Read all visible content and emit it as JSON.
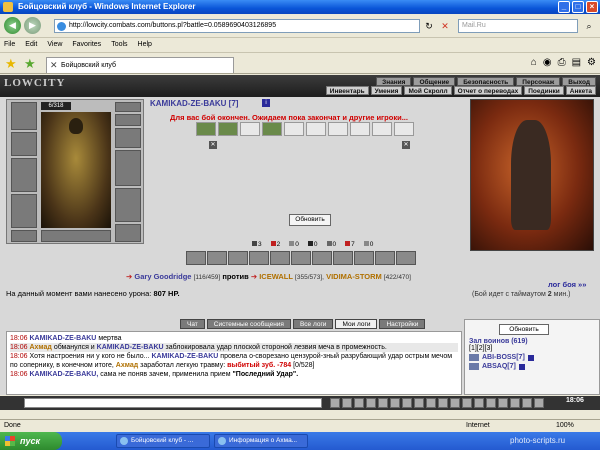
{
  "window": {
    "title": "Бойцовский клуб - Windows Internet Explorer"
  },
  "address": {
    "url": "http://lowcity.combats.com/buttons.pl?battle=0.0589690403126895",
    "search_placeholder": "Mail.Ru"
  },
  "menu": [
    "File",
    "Edit",
    "View",
    "Favorites",
    "Tools",
    "Help"
  ],
  "tab": {
    "title": "Бойцовский клуб"
  },
  "game": {
    "logo": "LOWCITY",
    "menu_top": [
      "Знания",
      "Общение",
      "Безопасность",
      "Персонаж",
      "Выход"
    ],
    "menu_bottom": [
      "Инвентарь",
      "Умения",
      "Мой Скролл",
      "Отчет о переводах",
      "Поединки",
      "Анкета"
    ],
    "hp": "6/318",
    "player": {
      "name": "KAMIKAD-ZE-BAKU [7]",
      "level_icon": "i"
    },
    "battle_msg": "Для вас бой окончен. Ожидаем пока закончат и другие игроки...",
    "refresh": "Обновить",
    "counters": [
      "3",
      "2",
      "0",
      "0",
      "0",
      "7",
      "0"
    ],
    "vs": {
      "left_name": "Gary Goodridge",
      "left_stat": "[116/459]",
      "word": "против",
      "r1_name": "ICEWALL",
      "r1_stat": "[355/573],",
      "r2_name": "VIDIMA-STORM",
      "r2_stat": "[422/470]"
    },
    "battle_log": "лог боя »»",
    "damage_prefix": "На данный момент вами нанесено урона:",
    "damage_value": "807 HP.",
    "timeout_prefix": "(Бой идет с таймаутом",
    "timeout_value": "2",
    "timeout_suffix": "мин.)"
  },
  "chat": {
    "tabs": [
      "Чат",
      "Системные сообщения",
      "Все логи",
      "Мои логи",
      "Настройки"
    ],
    "active_tab": "Мои логи",
    "log": {
      "l1_time": "18:06",
      "l1_name": "KAMIKAD-ZE-BAKU",
      "l1_text": "мертва",
      "l2_time": "18:06",
      "l2_name": "Ахмад",
      "l2_text_a": "обманулся и",
      "l2_name2": "KAMIKAD-ZE-BAKU",
      "l2_text_b": "заблокировала удар плоской стороной лезвия меча в промежность.",
      "l3_time": "18:06",
      "l3_text_a": "Хотя настроения ни у кого не было...",
      "l3_name": "KAMIKAD-ZE-BAKU",
      "l3_text_b": "провела о-сворезано цензурой-зный разрубающий удар острым мечом по сопернику, в конечном итоге,",
      "l3_name2": "Ахмад",
      "l3_text_c": "заработал легкую травму:",
      "l3_injury": "выбитый зуб.",
      "l3_dmg": "-784",
      "l3_hp": "[0/528]",
      "l4_time": "18:06",
      "l4_name": "KAMIKAD-ZE-BAKU,",
      "l4_text": "сама не поняв зачем, применила прием",
      "l4_skill": "\"Последний Удар\"."
    }
  },
  "warriors": {
    "refresh": "Обновить",
    "title": "Зал воинов (619)",
    "pages": "[1][2][3]",
    "items": [
      {
        "name": "ABI-BOSS[7]"
      },
      {
        "name": "ABSAQ[7]"
      }
    ]
  },
  "clock": "18:06",
  "status": {
    "left": "Done",
    "zone": "Internet",
    "zoom": "100%"
  },
  "taskbar": {
    "start": "пуск",
    "items": [
      "Бойцовский клуб - ...",
      "Информация о Ахма..."
    ],
    "watermark": "photo-scripts.ru"
  },
  "colors": {
    "titlebar": "#0a55d8",
    "accent_red": "#d00000",
    "name_blue": "#3a3a9a",
    "name_orange": "#b07000"
  }
}
